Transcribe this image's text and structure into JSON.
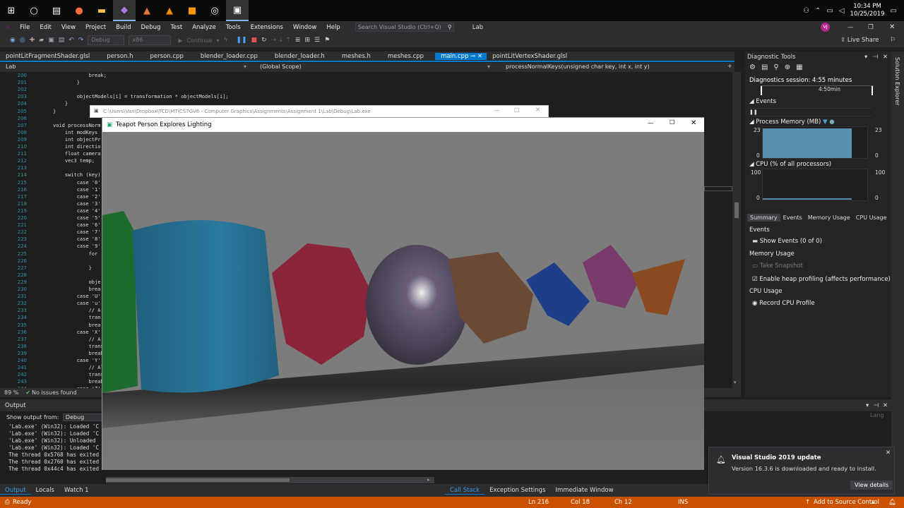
{
  "taskbar": {
    "time": "10:34 PM",
    "date": "10/25/2019"
  },
  "menu": {
    "items": [
      "File",
      "Edit",
      "View",
      "Project",
      "Build",
      "Debug",
      "Test",
      "Analyze",
      "Tools",
      "Extensions",
      "Window",
      "Help"
    ],
    "search_placeholder": "Search Visual Studio (Ctrl+Q)",
    "solution_name": "Lab",
    "user_initials": "VJ",
    "live_share": "Live Share"
  },
  "toolbar": {
    "config": "Debug",
    "platform": "x86",
    "continue_label": "Continue"
  },
  "tabs": [
    "pointLitFragmentShader.glsl",
    "person.h",
    "person.cpp",
    "blender_loader.cpp",
    "blender_loader.h",
    "meshes.h",
    "meshes.cpp",
    "main.cpp",
    "pointLitVertexShader.glsl"
  ],
  "scope": {
    "project": "Lab",
    "scope": "(Global Scope)",
    "function": "processNormalKeys(unsigned char key, int x, int y)"
  },
  "editor": {
    "lines": [
      {
        "n": "200",
        "t": "            break;"
      },
      {
        "n": "201",
        "t": "        }"
      },
      {
        "n": "202",
        "t": ""
      },
      {
        "n": "203",
        "t": "        objectModels[i] = transformation * objectModels[i];"
      },
      {
        "n": "204",
        "t": "    }"
      },
      {
        "n": "205",
        "t": "}"
      },
      {
        "n": "206",
        "t": ""
      },
      {
        "n": "207",
        "t": "void processNorm"
      },
      {
        "n": "208",
        "t": "    int modKeys"
      },
      {
        "n": "209",
        "t": "    int objectPr"
      },
      {
        "n": "210",
        "t": "    int directio"
      },
      {
        "n": "211",
        "t": "    float camera"
      },
      {
        "n": "212",
        "t": "    vec3 temp;"
      },
      {
        "n": "213",
        "t": ""
      },
      {
        "n": "214",
        "t": "    switch (key)"
      },
      {
        "n": "215",
        "t": "        case '0':"
      },
      {
        "n": "216",
        "t": "        case '1':"
      },
      {
        "n": "217",
        "t": "        case '2':"
      },
      {
        "n": "218",
        "t": "        case '3':"
      },
      {
        "n": "219",
        "t": "        case '4':"
      },
      {
        "n": "220",
        "t": "        case '5':"
      },
      {
        "n": "221",
        "t": "        case '6':"
      },
      {
        "n": "222",
        "t": "        case '7':"
      },
      {
        "n": "223",
        "t": "        case '8':"
      },
      {
        "n": "224",
        "t": "        case '9':"
      },
      {
        "n": "225",
        "t": "            for"
      },
      {
        "n": "226",
        "t": ""
      },
      {
        "n": "227",
        "t": "            }"
      },
      {
        "n": "228",
        "t": ""
      },
      {
        "n": "229",
        "t": "            obje"
      },
      {
        "n": "230",
        "t": "            brea"
      },
      {
        "n": "231",
        "t": "        case 'U'"
      },
      {
        "n": "232",
        "t": "        case 'u'"
      },
      {
        "n": "233",
        "t": "            // A"
      },
      {
        "n": "234",
        "t": "            tran"
      },
      {
        "n": "235",
        "t": "            brea"
      },
      {
        "n": "236",
        "t": "        case 'X'"
      },
      {
        "n": "237",
        "t": "            // A"
      },
      {
        "n": "238",
        "t": "            transfor"
      },
      {
        "n": "239",
        "t": "            break;"
      },
      {
        "n": "240",
        "t": "        case 'Y':"
      },
      {
        "n": "241",
        "t": "            // Alt k"
      },
      {
        "n": "242",
        "t": "            transfor"
      },
      {
        "n": "243",
        "t": "            break;"
      },
      {
        "n": "244",
        "t": "        case 'Z':"
      }
    ]
  },
  "zoom": {
    "level": "89 %",
    "issues": "No issues found"
  },
  "output": {
    "title": "Output",
    "source_label": "Show output from:",
    "source_value": "Debug",
    "lines": [
      "'Lab.exe' (Win32): Loaded 'C",
      "'Lab.exe' (Win32): Loaded 'C",
      "'Lab.exe' (Win32): Unloaded",
      "'Lab.exe' (Win32): Loaded 'C",
      "The thread 0x5768 has exited",
      "The thread 0x2760 has exited",
      "The thread 0x44c4 has exited"
    ],
    "lang_hint": "Lang"
  },
  "bottom_tabs_left": [
    "Output",
    "Locals",
    "Watch 1"
  ],
  "bottom_tabs_right": [
    "Call Stack",
    "Exception Settings",
    "Immediate Window"
  ],
  "status": {
    "ready": "Ready",
    "ln": "Ln 216",
    "col": "Col 18",
    "ch": "Ch 12",
    "ins": "INS",
    "source_control": "Add to Source Control"
  },
  "diagnostics": {
    "title": "Diagnostic Tools",
    "session": "Diagnostics session: 4:55 minutes",
    "timeline": "4:50min",
    "events": "Events",
    "memory_title": "Process Memory (MB)",
    "memory_max": "23",
    "memory_min": "0",
    "cpu_title": "CPU (% of all processors)",
    "cpu_max": "100",
    "cpu_min": "0",
    "tabs": [
      "Summary",
      "Events",
      "Memory Usage",
      "CPU Usage"
    ],
    "events_section": "Events",
    "show_events": "Show Events (0 of 0)",
    "memory_section": "Memory Usage",
    "take_snapshot": "Take Snapshot",
    "heap_profiling": "Enable heap profiling (affects performance)",
    "cpu_section": "CPU Usage",
    "record_cpu": "Record CPU Profile"
  },
  "solution_explorer": "Solution Explorer",
  "console": {
    "path": "C:\\Users\\Van\\Dropbox\\TCD\\MT\\CS7GV6 - Computer Graphics\\Assignments\\Assignment 1\\Lab\\Debug\\Lab.exe"
  },
  "app_window": {
    "title": "Teapot Person Explores Lighting"
  },
  "notification": {
    "title": "Visual Studio 2019 update",
    "body": "Version 16.3.6 is downloaded and ready to install.",
    "button": "View details"
  }
}
